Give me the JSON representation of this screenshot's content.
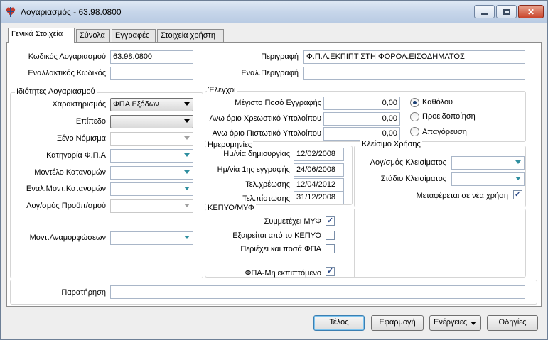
{
  "window": {
    "title": "Λογαριασμός - 63.98.0800",
    "controls": {
      "minimize": "—",
      "maximize": "□",
      "close": "✕"
    }
  },
  "tabs": [
    {
      "label": "Γενικά Στοιχεία",
      "active": true
    },
    {
      "label": "Σύνολα",
      "active": false
    },
    {
      "label": "Εγγραφές",
      "active": false
    },
    {
      "label": "Στοιχεία χρήστη",
      "active": false
    }
  ],
  "header_fields": {
    "account_code_label": "Κωδικός Λογαριασμού",
    "account_code_value": "63.98.0800",
    "alt_code_label": "Εναλλακτικός Κωδικός",
    "alt_code_value": "",
    "description_label": "Περιγραφή",
    "description_value": "Φ.Π.Α.ΕΚΠΙΠΤ ΣΤΗ ΦΟΡΟΛ.ΕΙΣΟΔΗΜΑΤΟΣ",
    "alt_description_label": "Εναλ.Περιγραφή",
    "alt_description_value": ""
  },
  "properties": {
    "title": "Ιδιότητες Λογαριασμού",
    "characterization_label": "Χαρακτηρισμός",
    "characterization_value": "ΦΠΑ Εξόδων",
    "level_label": "Επίπεδο",
    "level_value": "",
    "foreign_currency_label": "Ξένο Νόμισμα",
    "foreign_currency_value": "",
    "vat_category_label": "Κατηγορία Φ.Π.Α",
    "vat_category_value": "",
    "allocation_model_label": "Μοντέλο Κατανομών",
    "allocation_model_value": "",
    "alt_allocation_model_label": "Εναλ.Μοντ.Κατανομών",
    "alt_allocation_model_value": "",
    "budget_account_label": "Λογ/σμός Προϋπ/σμού",
    "budget_account_value": "",
    "revaluation_model_label": "Μοντ.Αναμορφώσεων",
    "revaluation_model_value": ""
  },
  "controls_group": {
    "title": "Έλεγχοι",
    "max_amount_label": "Μέγιστο Ποσό Εγγραφής",
    "max_amount_value": "0,00",
    "debit_limit_label": "Ανω όριο Χρεωστικό Υπολοίπου",
    "debit_limit_value": "0,00",
    "credit_limit_label": "Ανω όριο Πιστωτικό Υπολοίπου",
    "credit_limit_value": "0,00",
    "radio_none": "Καθόλου",
    "radio_warning": "Προειδοποίηση",
    "radio_prohibit": "Απαγόρευση",
    "selected": "none"
  },
  "dates": {
    "title": "Ημερομηνίες",
    "created_label": "Ημ/νία δημιουργίας",
    "created_value": "12/02/2008",
    "first_entry_label": "Ημ/νία 1ης εγγραφής",
    "first_entry_value": "24/06/2008",
    "last_debit_label": "Τελ.χρέωσης",
    "last_debit_value": "12/04/2012",
    "last_credit_label": "Τελ.πίστωσης",
    "last_credit_value": "31/12/2008"
  },
  "closing": {
    "title": "Κλείσιμο Χρήσης",
    "closing_account_label": "Λογ/σμός Κλεισίματος",
    "closing_account_value": "",
    "closing_stage_label": "Στάδιο Κλεισίματος",
    "closing_stage_value": "",
    "carry_over_label": "Μεταφέρεται σε νέα χρήση",
    "carry_over_checked": true
  },
  "kepyo": {
    "title": "ΚΕΠΥΟ/ΜΥΦ",
    "participates_label": "Συμμετέχει ΜΥΦ",
    "participates_checked": true,
    "excluded_label": "Εξαιρείται από το ΚΕΠΥΟ",
    "excluded_checked": false,
    "includes_vat_label": "Περιέχει και ποσά ΦΠΑ",
    "includes_vat_checked": false,
    "non_deductible_label": "ΦΠΑ-Μη εκπιπτόμενο",
    "non_deductible_checked": true
  },
  "remark": {
    "label": "Παρατήρηση",
    "value": ""
  },
  "buttons": {
    "ok": "Τέλος",
    "apply": "Εφαρμογή",
    "actions": "Ενέργειες",
    "help": "Οδηγίες"
  },
  "check_mark": "✓"
}
